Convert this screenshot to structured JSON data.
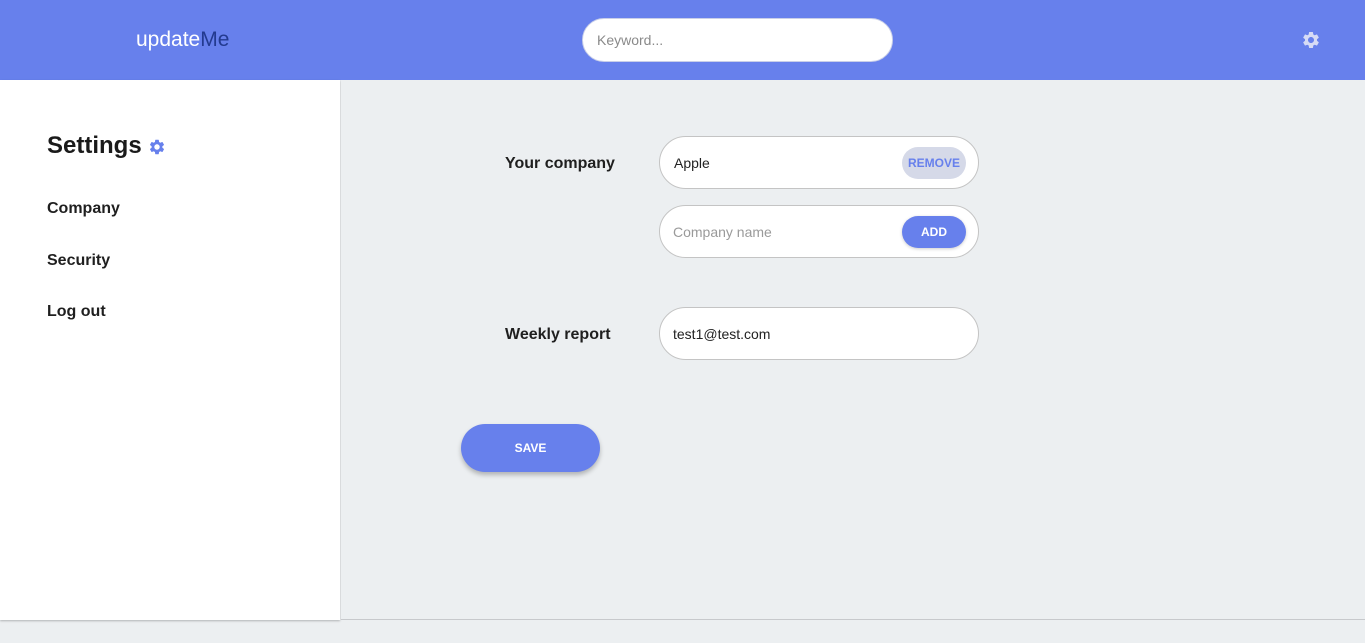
{
  "header": {
    "logo_part1": "update",
    "logo_part2": "Me",
    "search_placeholder": "Keyword...",
    "settings_icon": "gear-icon"
  },
  "sidebar": {
    "title": "Settings",
    "title_icon": "gear-icon",
    "items": [
      {
        "label": "Company"
      },
      {
        "label": "Security"
      },
      {
        "label": "Log out"
      }
    ]
  },
  "main": {
    "company_label": "Your company",
    "company_value": "Apple",
    "remove_label": "REMOVE",
    "company_placeholder": "Company name",
    "add_label": "ADD",
    "report_label": "Weekly report",
    "report_value": "test1@test.com",
    "save_label": "SAVE"
  },
  "colors": {
    "accent": "#6780ec",
    "logo_dark": "#233a8f",
    "background": "#eceff1",
    "remove_bg": "#d5d9e8"
  }
}
